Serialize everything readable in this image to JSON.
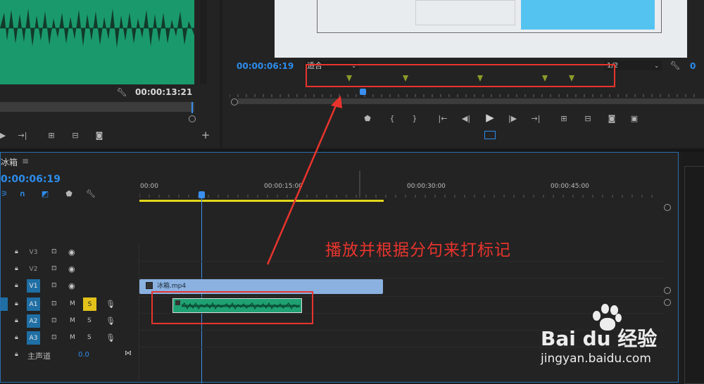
{
  "source_monitor": {
    "timecode": "00:00:13:21"
  },
  "program_monitor": {
    "timecode": "00:00:06:19",
    "fit_label": "适合",
    "resolution": "1/2",
    "marker_count": 5
  },
  "timeline": {
    "title": "冰箱",
    "menu_glyph": "≡",
    "timecode": "0:00:06:19",
    "ruler": [
      "00:00",
      "00:00:15:00",
      "00:00:30:00",
      "00:00:45:00"
    ],
    "tracks": [
      {
        "name": "V3",
        "active": false
      },
      {
        "name": "V2",
        "active": false
      },
      {
        "name": "V1",
        "active": true
      },
      {
        "name": "A1",
        "active": true,
        "solo": true
      },
      {
        "name": "A2",
        "active": true,
        "solo": false
      },
      {
        "name": "A3",
        "active": true,
        "solo": false
      }
    ],
    "master_label": "主声道",
    "master_value": "0.0",
    "m_label": "M",
    "s_label": "S",
    "clip_name": "冰箱.mp4"
  },
  "annotation": {
    "text": "播放并根据分句来打标记",
    "color": "#e8342d"
  },
  "watermark": {
    "brand": "Bai du 经验",
    "url": "jingyan.baidu.com"
  },
  "colors": {
    "accent": "#2d8ceb",
    "waveform": "#1fa173",
    "clip_video": "#8ab1e0",
    "marker": "#8c9a2a",
    "playhead": "#3a8ff0",
    "annotation": "#e8342d"
  }
}
